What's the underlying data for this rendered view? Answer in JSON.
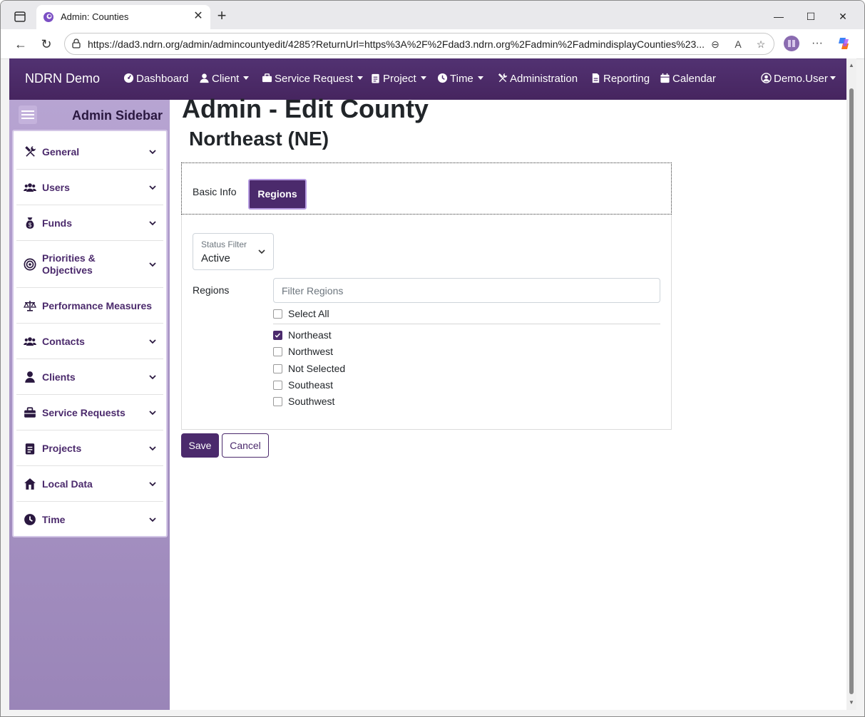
{
  "browser": {
    "tab_title": "Admin: Counties",
    "url": "https://dad3.ndrn.org/admin/admincountyedit/4285?ReturnUrl=https%3A%2F%2Fdad3.ndrn.org%2Fadmin%2FadmindisplayCounties%23..."
  },
  "navbar": {
    "brand": "NDRN Demo",
    "items": [
      {
        "label": "Dashboard",
        "icon": "dashboard-icon"
      },
      {
        "label": "Client",
        "icon": "user-icon",
        "dropdown": true
      },
      {
        "label": "Service Request",
        "icon": "briefcase-icon",
        "dropdown": true
      },
      {
        "label": "Project",
        "icon": "clipboard-icon",
        "dropdown": true
      },
      {
        "label": "Time",
        "icon": "clock-icon",
        "dropdown": true
      },
      {
        "label": "Administration",
        "icon": "tools-icon"
      },
      {
        "label": "Reporting",
        "icon": "file-icon"
      },
      {
        "label": "Calendar",
        "icon": "calendar-icon"
      }
    ],
    "user": "Demo.User"
  },
  "sidebar": {
    "title": "Admin Sidebar",
    "items": [
      {
        "label": "General",
        "icon": "tools-icon",
        "chevron": true
      },
      {
        "label": "Users",
        "icon": "users-icon",
        "chevron": true
      },
      {
        "label": "Funds",
        "icon": "money-bag-icon",
        "chevron": true
      },
      {
        "label": "Priorities &\nObjectives",
        "icon": "target-icon",
        "chevron": true
      },
      {
        "label": "Performance Measures",
        "icon": "scale-icon",
        "chevron": false
      },
      {
        "label": "Contacts",
        "icon": "users-icon",
        "chevron": true
      },
      {
        "label": "Clients",
        "icon": "user-icon",
        "chevron": true
      },
      {
        "label": "Service Requests",
        "icon": "briefcase-icon",
        "chevron": true
      },
      {
        "label": "Projects",
        "icon": "clipboard-icon",
        "chevron": true
      },
      {
        "label": "Local Data",
        "icon": "home-icon",
        "chevron": true
      },
      {
        "label": "Time",
        "icon": "clock-icon",
        "chevron": true
      }
    ]
  },
  "main": {
    "title": "Admin - Edit County",
    "subtitle": "Northeast (NE)",
    "tabs": [
      {
        "label": "Basic Info",
        "active": false
      },
      {
        "label": "Regions",
        "active": true
      }
    ],
    "status_filter": {
      "label": "Status Filter",
      "value": "Active"
    },
    "regions_label": "Regions",
    "filter_placeholder": "Filter Regions",
    "select_all": "Select All",
    "regions": [
      {
        "label": "Northeast",
        "checked": true
      },
      {
        "label": "Northwest",
        "checked": false
      },
      {
        "label": "Not Selected",
        "checked": false
      },
      {
        "label": "Southeast",
        "checked": false
      },
      {
        "label": "Southwest",
        "checked": false
      }
    ],
    "save_label": "Save",
    "cancel_label": "Cancel"
  },
  "colors": {
    "brand_purple": "#4b2a6c",
    "navbar": "#523272",
    "sidebar": "#b7a4d2"
  }
}
